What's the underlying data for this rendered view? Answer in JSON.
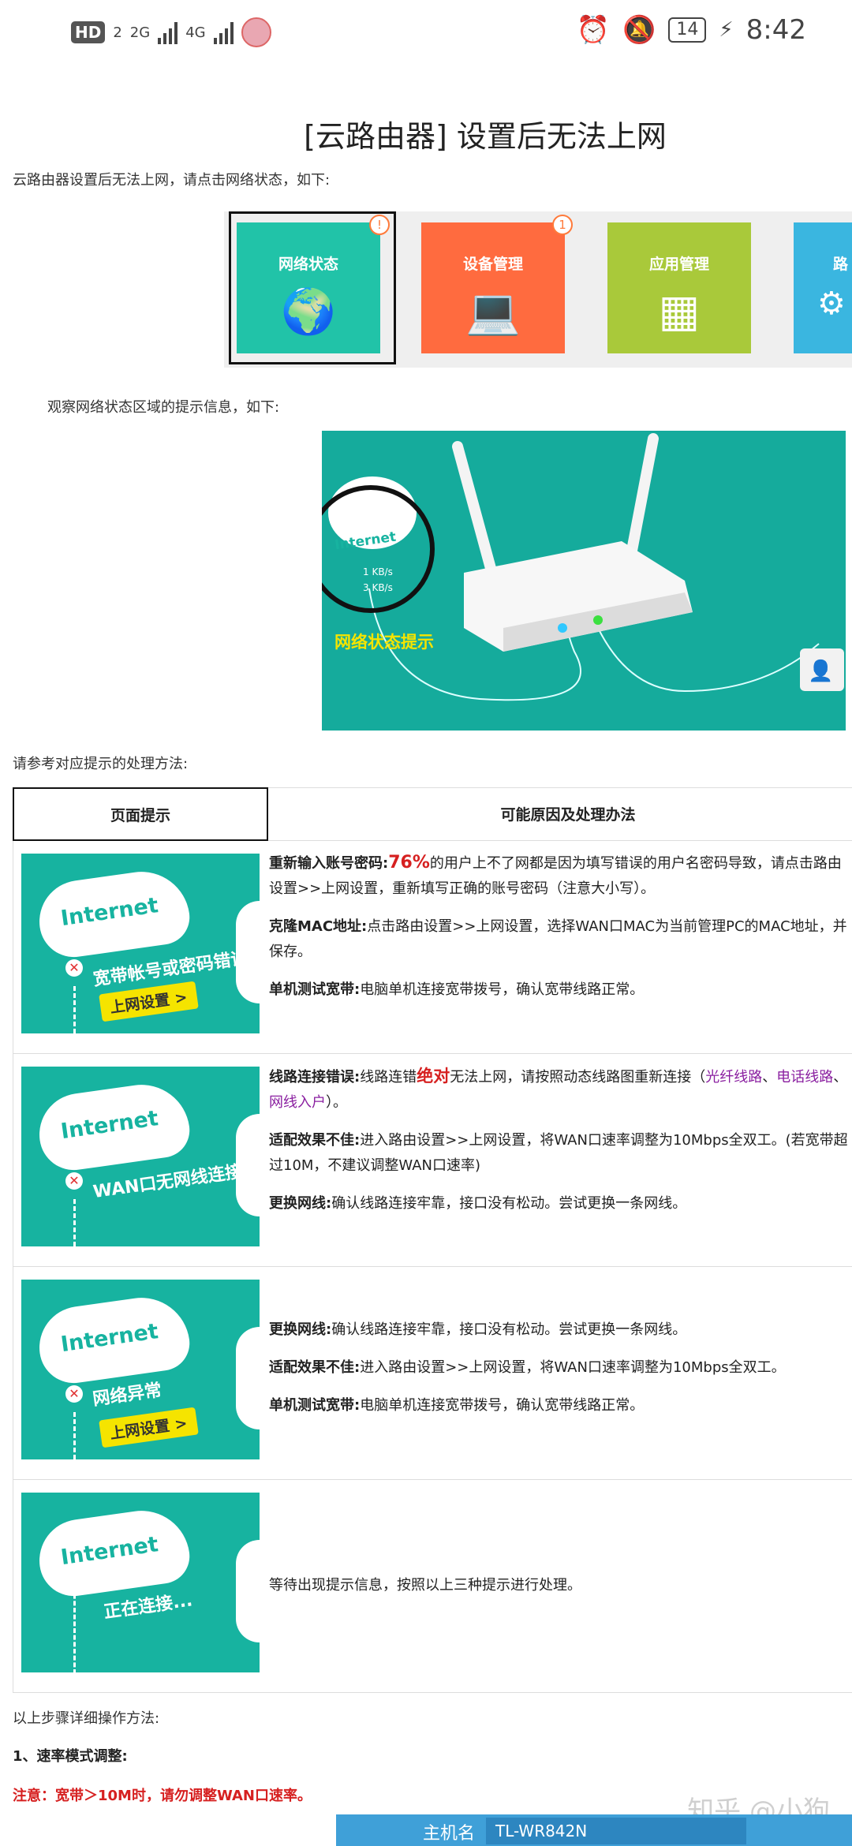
{
  "status_bar": {
    "hd_label": "HD",
    "hd_sub": "2",
    "sig1_label": "2G",
    "sig2_label": "4G",
    "battery": "14",
    "time": "8:42"
  },
  "article": {
    "title": "[云路由器] 设置后无法上网",
    "intro": "云路由器设置后无法上网，请点击网络状态，如下:",
    "observe": "观察网络状态区域的提示信息，如下:",
    "refer": "请参考对应提示的处理方法:",
    "detail_intro": "以上步骤详细操作方法:",
    "step1": "1、速率模式调整:",
    "warning": "注意：宽带＞10M时，请勿调整WAN口速率。"
  },
  "tiles": [
    {
      "label": "网络状态",
      "icon": "globe-icon",
      "badge": "!",
      "color": "#21c3a8"
    },
    {
      "label": "设备管理",
      "icon": "laptop-icon",
      "badge": "1",
      "color": "#ff6b3f"
    },
    {
      "label": "应用管理",
      "icon": "apps-icon",
      "badge": "",
      "color": "#a9c93a"
    },
    {
      "label": "路",
      "icon": "gear-icon",
      "badge": "",
      "color": "#3ab6e0"
    }
  ],
  "router_image": {
    "cloud_label": "Internet",
    "up_speed": "1 KB/s",
    "down_speed": "3 KB/s",
    "caption": "网络状态提示"
  },
  "table": {
    "header_left": "页面提示",
    "header_right": "可能原因及处理办法",
    "rows": [
      {
        "cloud": "Internet",
        "message": "宽带帐号或密码错误",
        "button": "上网设置 >",
        "p1_bold": "重新输入账号密码:",
        "p1_red": "76%",
        "p1_text": "的用户上不了网都是因为填写错误的用户名密码导致，请点击路由设置>>上网设置，重新填写正确的账号密码（注意大小写）。",
        "p2_bold": "克隆MAC地址:",
        "p2_text": "点击路由设置>>上网设置，选择WAN口MAC为当前管理PC的MAC地址，并保存。",
        "p3_bold": "单机测试宽带:",
        "p3_text": "电脑单机连接宽带拨号，确认宽带线路正常。"
      },
      {
        "cloud": "Internet",
        "message": "WAN口无网线连接",
        "p1_bold": "线路连接错误:",
        "p1_text_a": "线路连错",
        "p1_red": "绝对",
        "p1_text_b": "无法上网，请按照动态线路图重新连接（",
        "p1_link1": "光纤线路",
        "p1_sep": "、",
        "p1_link2": "电话线路",
        "p1_sep2": "、",
        "p1_link3": "网线入户",
        "p1_end": "）。",
        "p2_bold": "适配效果不佳:",
        "p2_text": "进入路由设置>>上网设置，将WAN口速率调整为10Mbps全双工。(若宽带超过10M，不建议调整WAN口速率)",
        "p3_bold": "更换网线:",
        "p3_text": "确认线路连接牢靠，接口没有松动。尝试更换一条网线。"
      },
      {
        "cloud": "Internet",
        "message": "网络异常",
        "button": "上网设置 >",
        "p1_bold": "更换网线:",
        "p1_text": "确认线路连接牢靠，接口没有松动。尝试更换一条网线。",
        "p2_bold": "适配效果不佳:",
        "p2_text": "进入路由设置>>上网设置，将WAN口速率调整为10Mbps全双工。",
        "p3_bold": "单机测试宽带:",
        "p3_text": "电脑单机连接宽带拨号，确认宽带线路正常。"
      },
      {
        "cloud": "Internet",
        "message": "正在连接...",
        "p1_text": "等待出现提示信息，按照以上三种提示进行处理。"
      }
    ]
  },
  "watermark": "知乎 @小狗",
  "bottom_bar": {
    "key": "主机名",
    "value": "TL-WR842N"
  }
}
